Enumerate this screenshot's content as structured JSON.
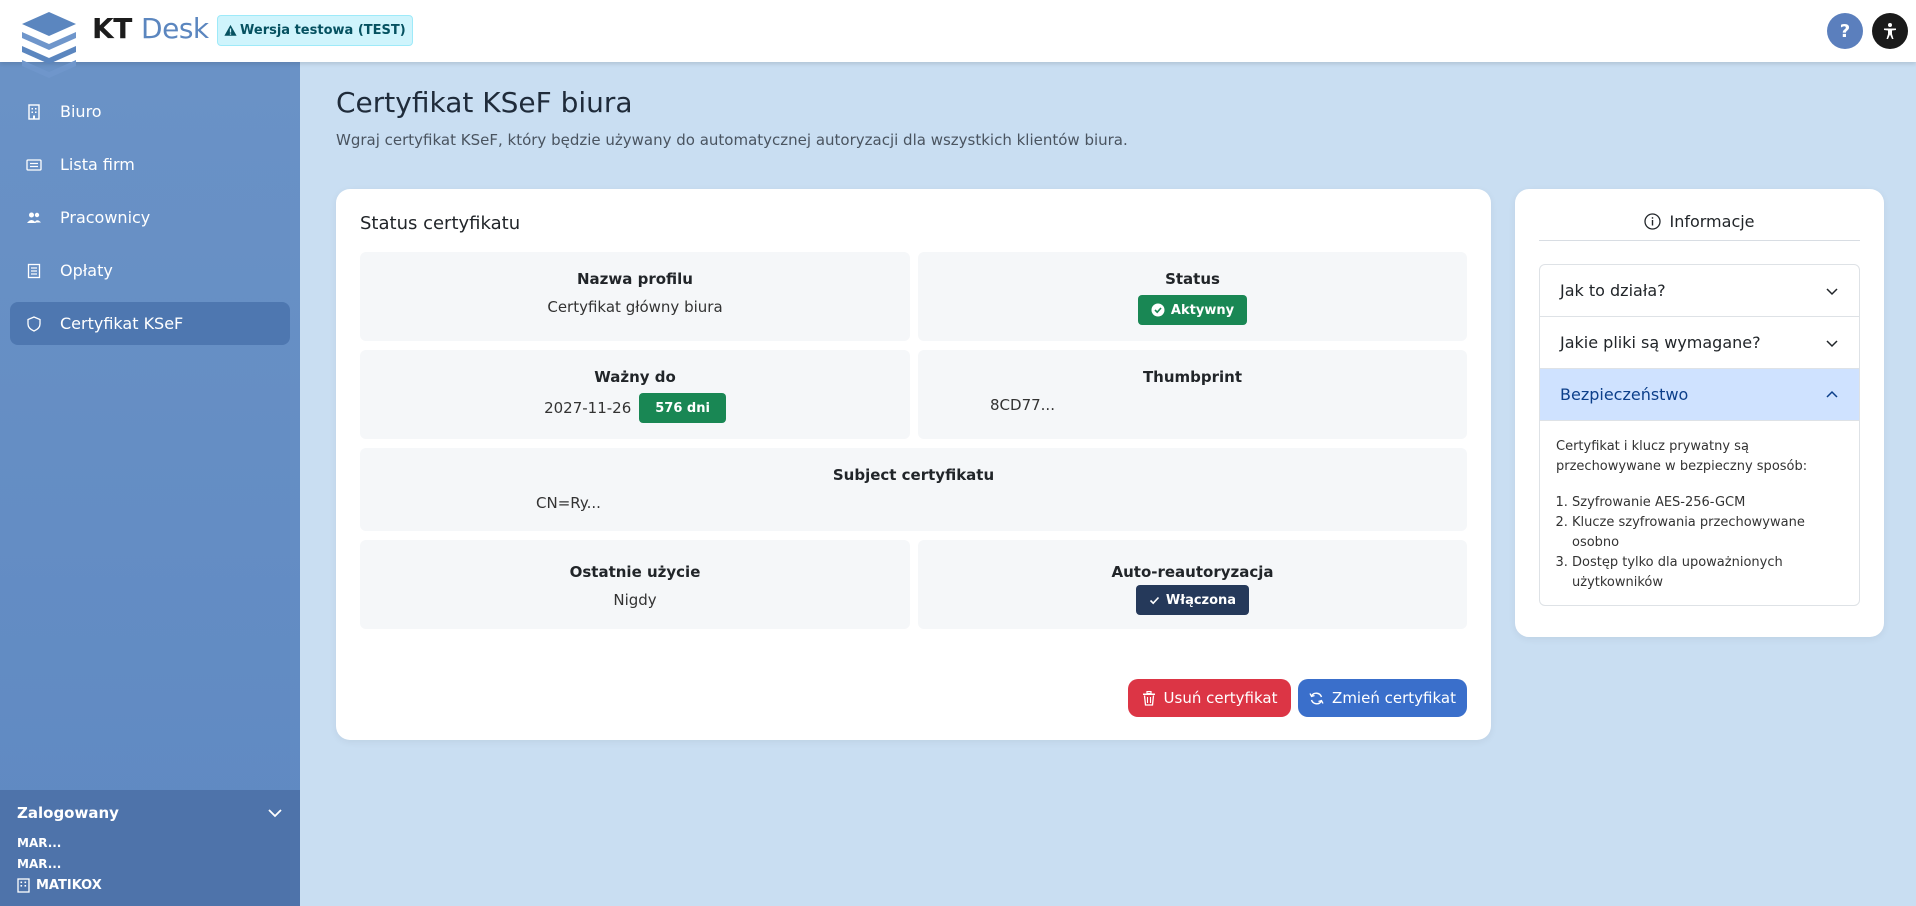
{
  "header": {
    "brand_primary": "KT",
    "brand_secondary": "Desk",
    "test_badge": "Wersja testowa (TEST)",
    "help_label": "?"
  },
  "sidebar": {
    "items": [
      {
        "label": "Biuro",
        "icon": "building-icon"
      },
      {
        "label": "Lista firm",
        "icon": "list-icon"
      },
      {
        "label": "Pracownicy",
        "icon": "people-icon"
      },
      {
        "label": "Opłaty",
        "icon": "receipt-icon"
      },
      {
        "label": "Certyfikat KSeF",
        "icon": "shield-icon",
        "active": true
      }
    ],
    "user": {
      "title": "Zalogowany",
      "line1": "MAR...",
      "line2": "MAR...",
      "company": "MATIKOX"
    }
  },
  "page": {
    "title": "Certyfikat KSeF biura",
    "subtitle": "Wgraj certyfikat KSeF, który będzie używany do automatycznej autoryzacji dla wszystkich klientów biura."
  },
  "status_card": {
    "title": "Status certyfikatu",
    "profile_label": "Nazwa profilu",
    "profile_value": "Certyfikat główny biura",
    "status_label": "Status",
    "status_value": "Aktywny",
    "valid_label": "Ważny do",
    "valid_value": "2027-11-26",
    "valid_days": "576 dni",
    "thumbprint_label": "Thumbprint",
    "thumbprint_value": "8CD77...",
    "subject_label": "Subject certyfikatu",
    "subject_value": "CN=Ry...",
    "last_used_label": "Ostatnie użycie",
    "last_used_value": "Nigdy",
    "auto_label": "Auto-reautoryzacja",
    "auto_value": "Włączona",
    "delete_button": "Usuń certyfikat",
    "change_button": "Zmień certyfikat"
  },
  "info_card": {
    "title": "Informacje",
    "items": [
      "Jak to działa?",
      "Jakie pliki są wymagane?",
      "Bezpieczeństwo"
    ],
    "security_text": "Certyfikat i klucz prywatny są przechowywane w bezpieczny sposób:",
    "security_list": [
      "Szyfrowanie AES-256-GCM",
      "Klucze szyfrowania przechowywane osobno",
      "Dostęp tylko dla upoważnionych użytkowników"
    ]
  },
  "colors": {
    "accent": "#3a6fcb",
    "danger": "#dc3545",
    "success": "#198754",
    "sidebar": "#6a92c6"
  }
}
